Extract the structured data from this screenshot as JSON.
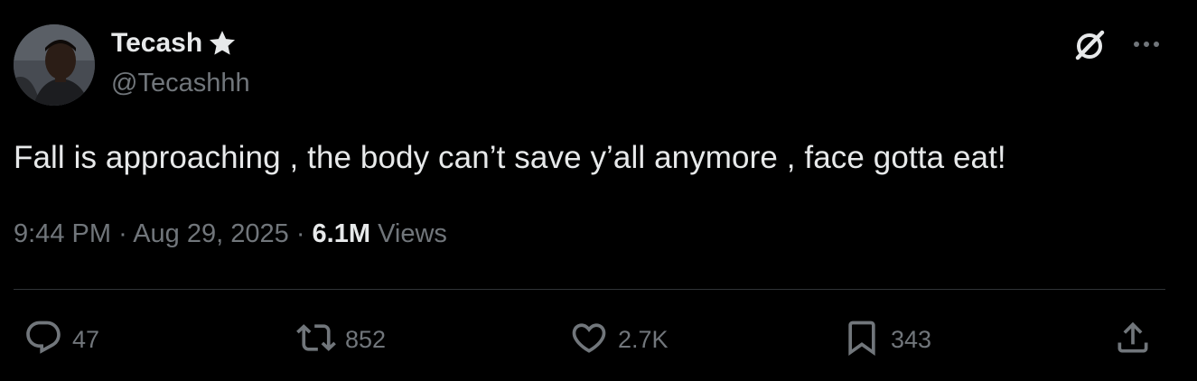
{
  "author": {
    "display_name": "Tecash",
    "handle": "@Tecashhh",
    "badge_icon": "star-icon"
  },
  "header_actions": {
    "grok_icon": "grok-icon",
    "more_icon": "more-icon"
  },
  "tweet": {
    "text": "Fall is approaching , the body can’t save y’all anymore , face gotta eat!",
    "time": "9:44 PM",
    "separator": "·",
    "date": "Aug 29, 2025",
    "views_count": "6.1M",
    "views_label": "Views"
  },
  "actions": {
    "replies": "47",
    "reposts": "852",
    "likes": "2.7K",
    "bookmarks": "343"
  },
  "colors": {
    "background": "#000000",
    "text_primary": "#e7e9ea",
    "text_secondary": "#71767b",
    "divider": "#2f3336"
  }
}
